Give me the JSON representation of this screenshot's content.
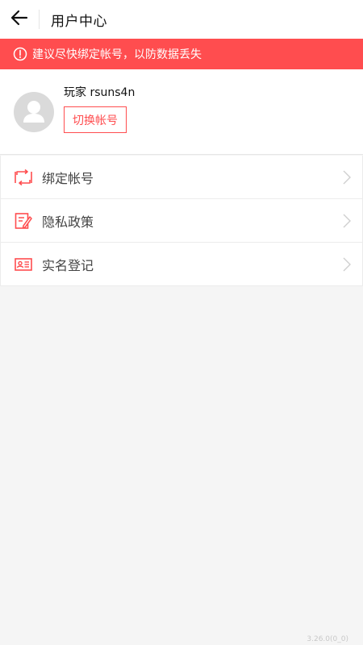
{
  "header": {
    "title": "用户中心",
    "back_icon": "arrow-left-icon"
  },
  "alert": {
    "text": "建议尽快绑定帐号，以防数据丢失",
    "icon": "warning-circle-icon",
    "color": "#ff4d4f"
  },
  "profile": {
    "avatar_icon": "user-avatar-icon",
    "player_name": "玩家 rsuns4n",
    "switch_label": "切换帐号"
  },
  "menu": {
    "items": [
      {
        "label": "绑定帐号",
        "icon": "bind-account-icon"
      },
      {
        "label": "隐私政策",
        "icon": "privacy-policy-icon"
      },
      {
        "label": "实名登记",
        "icon": "id-card-icon"
      }
    ]
  },
  "footer": {
    "version": "3.26.0(0_0)"
  },
  "colors": {
    "accent": "#ff4d4f",
    "background": "#f5f5f5"
  }
}
